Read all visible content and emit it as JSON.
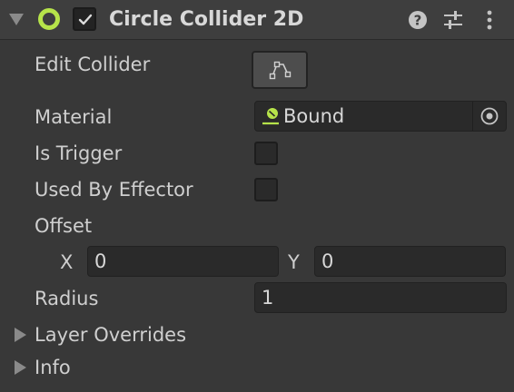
{
  "component": {
    "title": "Circle Collider 2D",
    "enabled": true,
    "icons": {
      "collider": "circle-collider-icon",
      "help": "help-icon",
      "presets": "presets-icon",
      "menu": "kebab-menu-icon"
    },
    "accent_color": "#b6e34a"
  },
  "properties": {
    "edit_collider_label": "Edit Collider",
    "material_label": "Material",
    "material_value": "Bound",
    "is_trigger_label": "Is Trigger",
    "is_trigger_checked": false,
    "used_by_effector_label": "Used By Effector",
    "used_by_effector_checked": false,
    "offset_label": "Offset",
    "offset_x_label": "X",
    "offset_x_value": "0",
    "offset_y_label": "Y",
    "offset_y_value": "0",
    "radius_label": "Radius",
    "radius_value": "1"
  },
  "foldouts": {
    "layer_overrides": "Layer Overrides",
    "info": "Info"
  }
}
